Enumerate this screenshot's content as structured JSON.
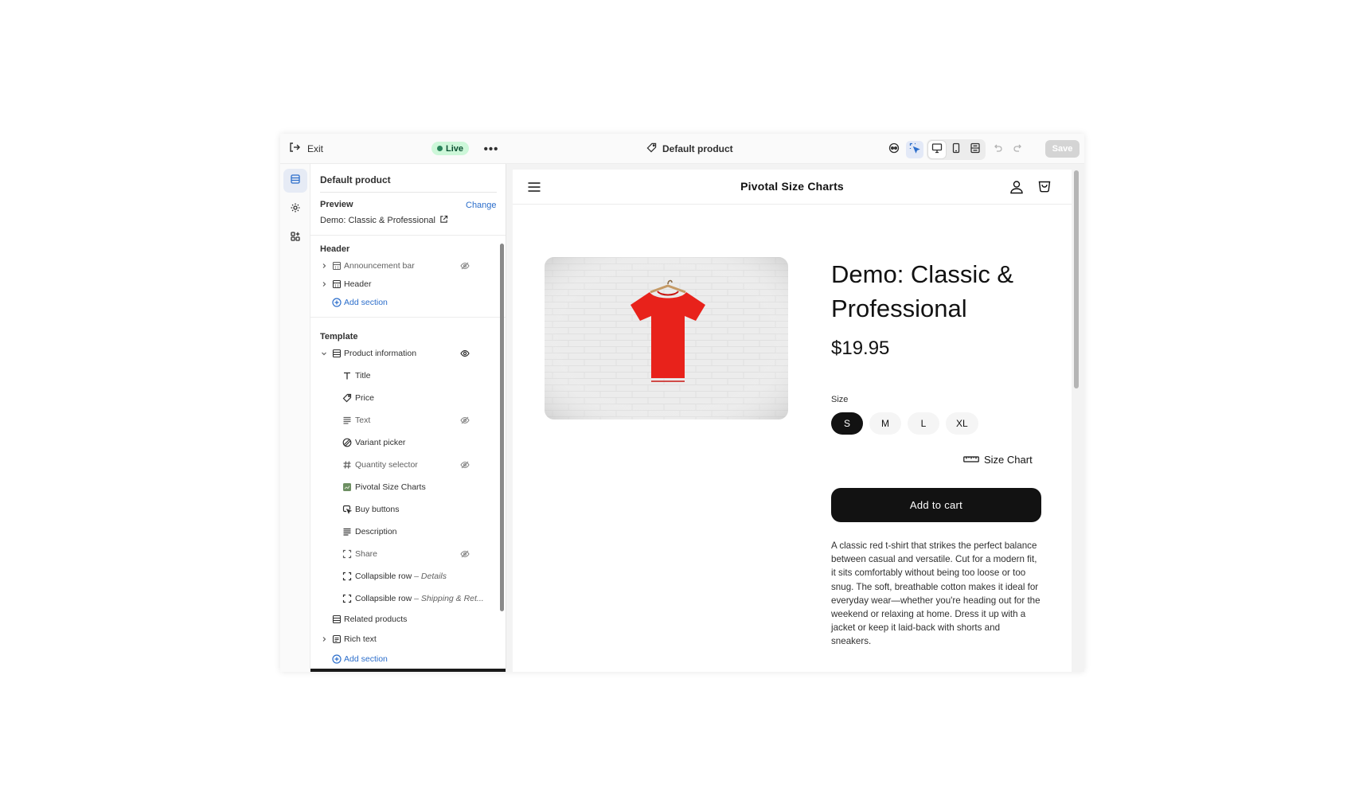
{
  "topbar": {
    "exit_label": "Exit",
    "status_badge": "Live",
    "more_label": "•••",
    "template_title": "Default product",
    "save_label": "Save"
  },
  "sidebar": {
    "title": "Default product",
    "preview": {
      "label": "Preview",
      "change_label": "Change",
      "value": "Demo: Classic & Professional"
    },
    "header_group": {
      "label": "Header",
      "items": [
        {
          "label": "Announcement bar",
          "hidden": true
        },
        {
          "label": "Header",
          "hidden": false
        }
      ],
      "add_section": "Add section"
    },
    "template_group": {
      "label": "Template",
      "section": "Product information",
      "blocks": [
        {
          "label": "Title",
          "icon": "text-icon",
          "hidden": false
        },
        {
          "label": "Price",
          "icon": "price-tag-icon",
          "hidden": false
        },
        {
          "label": "Text",
          "icon": "paragraph-icon",
          "hidden": true
        },
        {
          "label": "Variant picker",
          "icon": "variant-icon",
          "hidden": false
        },
        {
          "label": "Quantity selector",
          "icon": "hash-icon",
          "hidden": true
        },
        {
          "label": "Pivotal Size Charts",
          "icon": "app-icon",
          "hidden": false
        },
        {
          "label": "Buy buttons",
          "icon": "cursor-click-icon",
          "hidden": false
        },
        {
          "label": "Description",
          "icon": "paragraph-icon",
          "hidden": false
        },
        {
          "label": "Share",
          "icon": "frame-icon",
          "hidden": true
        },
        {
          "label": "Collapsible row",
          "suffix": "Details",
          "icon": "frame-icon",
          "hidden": false
        },
        {
          "label": "Collapsible row",
          "suffix": "Shipping & Ret...",
          "icon": "frame-icon",
          "hidden": false
        }
      ],
      "related": "Related products",
      "rich_text": "Rich text",
      "add_section": "Add section",
      "dash": " – "
    }
  },
  "store": {
    "name": "Pivotal Size Charts",
    "product_title": "Demo: Classic & Professional",
    "price": "$19.95",
    "size_label": "Size",
    "sizes": [
      "S",
      "M",
      "L",
      "XL"
    ],
    "selected_size": "S",
    "size_chart_label": "Size Chart",
    "add_to_cart": "Add to cart",
    "description": "A classic red t-shirt that strikes the perfect balance between casual and versatile. Cut for a modern fit, it sits comfortably without being too loose or too snug. The soft, breathable cotton makes it ideal for everyday wear—whether you're heading out for the weekend or relaxing at home. Dress it up with a jacket or keep it laid-back with shorts and sneakers."
  },
  "colors": {
    "accent": "#2c6ecb",
    "live_bg": "#cdf7d9",
    "live_text": "#0c5132",
    "shirt": "#e8221b",
    "button": "#121212"
  }
}
